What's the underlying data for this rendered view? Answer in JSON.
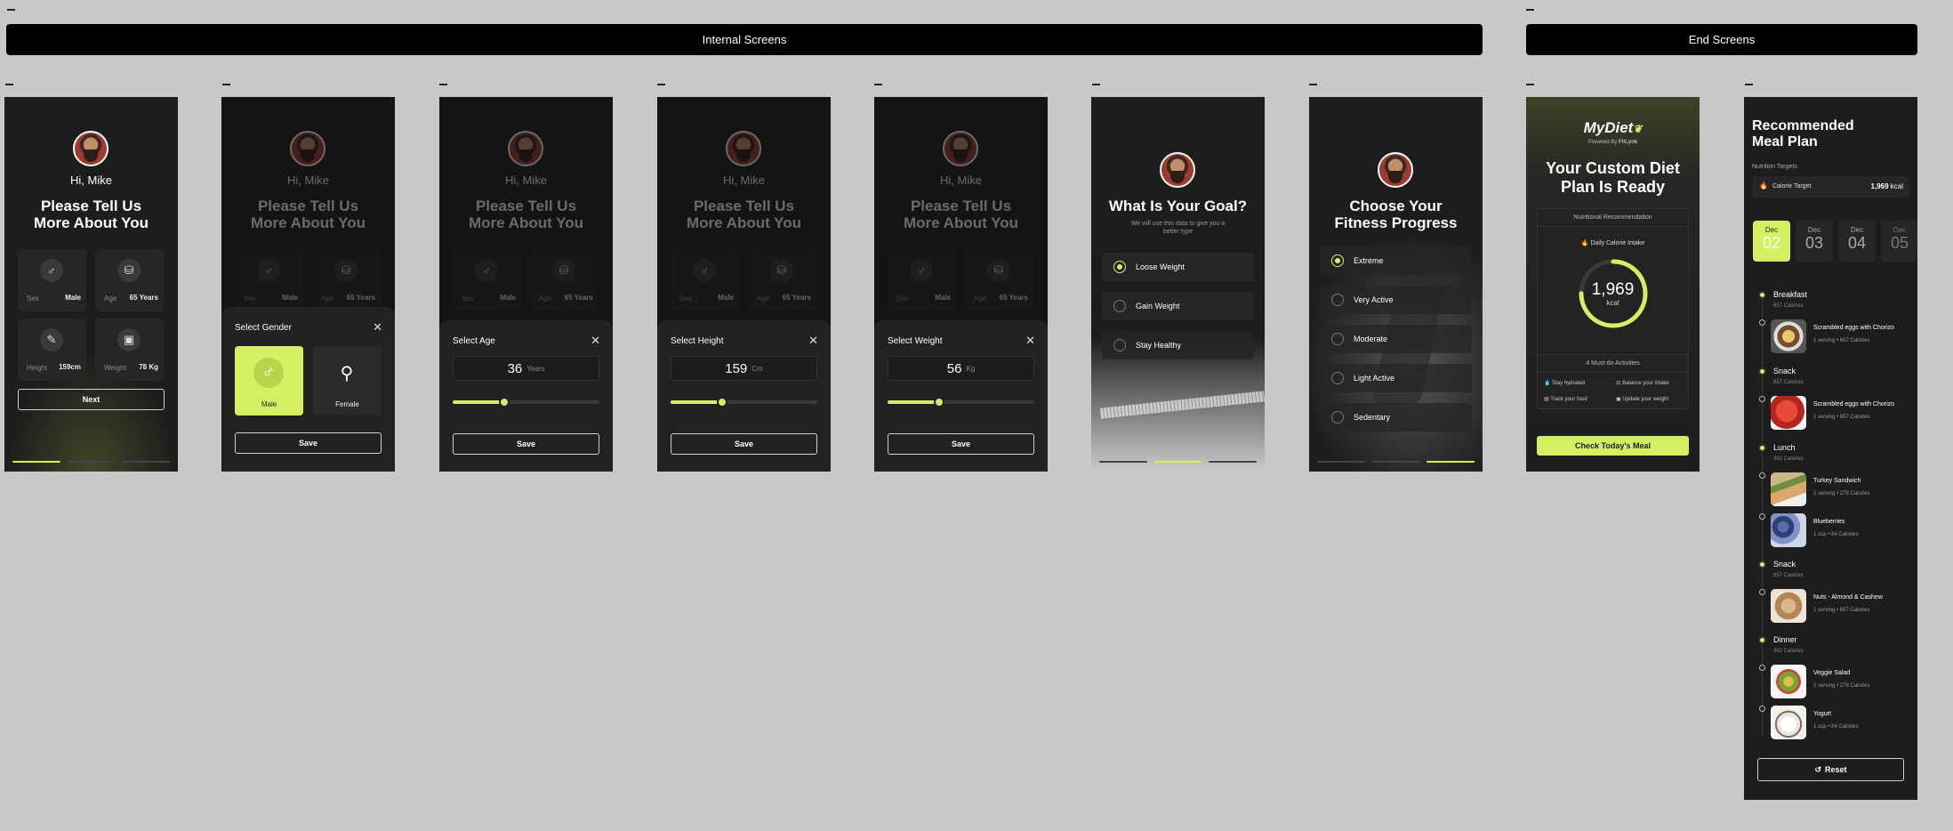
{
  "banners": {
    "internal": "Internal Screens",
    "end": "End Screens"
  },
  "colors": {
    "accent": "#d4f062",
    "screen_bg": "#1d1d1d",
    "canvas_bg": "#c8c8c8"
  },
  "onboarding": {
    "greeting": "Hi, Mike",
    "title_line1": "Please Tell Us",
    "title_line2": "More About You",
    "fields": {
      "sex": {
        "label": "Sex",
        "value": "Male",
        "icon": "male-icon"
      },
      "age": {
        "label": "Age",
        "value": "65 Years",
        "icon": "cake-icon"
      },
      "height": {
        "label": "Height",
        "value": "159cm",
        "icon": "ruler-icon"
      },
      "weight": {
        "label": "Weight",
        "value": "78 Kg",
        "icon": "scale-icon"
      }
    },
    "next_label": "Next"
  },
  "gender_sheet": {
    "title": "Select Gender",
    "male": "Male",
    "female": "Female",
    "save": "Save"
  },
  "age_sheet": {
    "title": "Select Age",
    "value": "36",
    "unit": "Years",
    "level": 0.35,
    "save": "Save"
  },
  "height_sheet": {
    "title": "Select Height",
    "value": "159",
    "unit": "Cm",
    "level": 0.35,
    "save": "Save"
  },
  "weight_sheet": {
    "title": "Select Weight",
    "value": "56",
    "unit": "Kg",
    "level": 0.35,
    "save": "Save"
  },
  "goal": {
    "title": "What Is Your Goal?",
    "subtitle_line1": "We will use this data to give you a",
    "subtitle_line2": "better type",
    "options": [
      "Loose Weight",
      "Gain Weight",
      "Stay Healthy"
    ],
    "selected": 0
  },
  "fitness": {
    "title_line1": "Choose Your",
    "title_line2": "Fitness Progress",
    "options": [
      "Extreme",
      "Very Active",
      "Moderate",
      "Light Active",
      "Sedentary"
    ],
    "selected": 0
  },
  "plan": {
    "brand": "MyDiet",
    "powered_prefix": "Powered By",
    "powered_brand": "FitLynk",
    "title_line1": "Your Custom Diet",
    "title_line2": "Plan Is Ready",
    "recommendation_label": "Nutritional Recommendation",
    "daily_label": "Daily Calorie Intake",
    "kcal_value": "1,969",
    "kcal_unit": "kcal",
    "ring_fraction": 0.75,
    "activities_label": "4 Must-do Activities",
    "activities": [
      "Stay hydrated",
      "Balance your intake",
      "Track your food",
      "Update your weight"
    ],
    "cta": "Check Today's Meal"
  },
  "meal_plan": {
    "title_line1": "Recommended",
    "title_line2": "Meal Plan",
    "targets_label": "Nutrition Targets",
    "target_name": "Calorie Target",
    "target_value": "1,969",
    "target_unit": "kcal",
    "dates": [
      {
        "month": "Dec",
        "day": "02"
      },
      {
        "month": "Dec",
        "day": "03"
      },
      {
        "month": "Dec",
        "day": "04"
      },
      {
        "month": "Dec",
        "day": "05"
      }
    ],
    "sections": [
      {
        "name": "Breakfast",
        "cal": "657 Calories",
        "items": [
          {
            "name": "Scrambled eggs with Chorizo",
            "serving": "1 serving",
            "cal": "657 Calories"
          }
        ]
      },
      {
        "name": "Snack",
        "cal": "657 Calories",
        "items": [
          {
            "name": "Scrambled eggs with Chorizo",
            "serving": "1 serving",
            "cal": "657 Calories"
          }
        ]
      },
      {
        "name": "Lunch",
        "cal": "362 Calories",
        "items": [
          {
            "name": "Turkey Sandwich",
            "serving": "1 serving",
            "cal": "278 Calories"
          },
          {
            "name": "Blueberries",
            "serving": "1 cup",
            "cal": "84 Calories"
          }
        ]
      },
      {
        "name": "Snack",
        "cal": "657 Calories",
        "items": [
          {
            "name": "Nuts - Almond & Cashew",
            "serving": "1 serving",
            "cal": "657 Calories"
          }
        ]
      },
      {
        "name": "Dinner",
        "cal": "362 Calories",
        "items": [
          {
            "name": "Veggie Salad",
            "serving": "1 serving",
            "cal": "278 Calories"
          },
          {
            "name": "Yogurt",
            "serving": "1 cup",
            "cal": "84 Calories"
          }
        ]
      }
    ],
    "reset_label": "Reset"
  }
}
